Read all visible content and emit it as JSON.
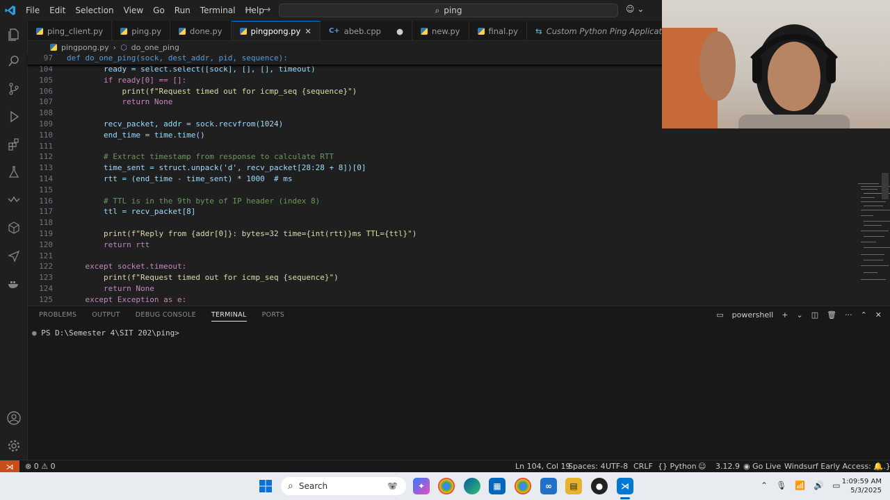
{
  "menu": [
    "File",
    "Edit",
    "Selection",
    "View",
    "Go",
    "Run",
    "Terminal",
    "Help"
  ],
  "search": {
    "text": "ping"
  },
  "tabs": [
    {
      "label": "ping_client.py",
      "type": "py",
      "active": false
    },
    {
      "label": "ping.py",
      "type": "py",
      "active": false
    },
    {
      "label": "done.py",
      "type": "py",
      "active": false
    },
    {
      "label": "pingpong.py",
      "type": "py",
      "active": true
    },
    {
      "label": "abeb.cpp",
      "type": "cpp",
      "active": false,
      "modified": true
    },
    {
      "label": "new.py",
      "type": "py",
      "active": false
    },
    {
      "label": "final.py",
      "type": "py",
      "active": false
    },
    {
      "label": "Custom Python Ping Application.c",
      "type": "preview",
      "active": false
    }
  ],
  "breadcrumb": {
    "file": "pingpong.py",
    "symbol": "do_one_ping"
  },
  "sticky": {
    "num": "97",
    "text": "def do_one_ping(sock, dest_addr, pid, sequence):"
  },
  "lines": [
    {
      "num": "104",
      "text": "        ready = select.select([sock], [], [], timeout)"
    },
    {
      "num": "105",
      "text": "        if ready[0] == []:"
    },
    {
      "num": "106",
      "text": "            print(f\"Request timed out for icmp_seq {sequence}\")"
    },
    {
      "num": "107",
      "text": "            return None"
    },
    {
      "num": "108",
      "text": ""
    },
    {
      "num": "109",
      "text": "        recv_packet, addr = sock.recvfrom(1024)"
    },
    {
      "num": "110",
      "text": "        end_time = time.time()"
    },
    {
      "num": "111",
      "text": ""
    },
    {
      "num": "112",
      "text": "        # Extract timestamp from response to calculate RTT"
    },
    {
      "num": "113",
      "text": "        time_sent = struct.unpack('d', recv_packet[28:28 + 8])[0]"
    },
    {
      "num": "114",
      "text": "        rtt = (end_time - time_sent) * 1000  # ms"
    },
    {
      "num": "115",
      "text": ""
    },
    {
      "num": "116",
      "text": "        # TTL is in the 9th byte of IP header (index 8)"
    },
    {
      "num": "117",
      "text": "        ttl = recv_packet[8]"
    },
    {
      "num": "118",
      "text": ""
    },
    {
      "num": "119",
      "text": "        print(f\"Reply from {addr[0]}: bytes=32 time={int(rtt)}ms TTL={ttl}\")"
    },
    {
      "num": "120",
      "text": "        return rtt"
    },
    {
      "num": "121",
      "text": ""
    },
    {
      "num": "122",
      "text": "    except socket.timeout:"
    },
    {
      "num": "123",
      "text": "        print(f\"Request timed out for icmp_seq {sequence}\")"
    },
    {
      "num": "124",
      "text": "        return None"
    },
    {
      "num": "125",
      "text": "    except Exception as e:"
    }
  ],
  "panel": {
    "tabs": [
      "PROBLEMS",
      "OUTPUT",
      "DEBUG CONSOLE",
      "TERMINAL",
      "PORTS"
    ],
    "active_tab": "TERMINAL",
    "shell": "powershell",
    "prompt": "PS D:\\Semester 4\\SIT 202\\ping>"
  },
  "status": {
    "problems": "0",
    "warnings": "0",
    "position": "Ln 104, Col 19",
    "spaces": "Spaces: 4",
    "encoding": "UTF-8",
    "eol": "CRLF",
    "language": "Python",
    "version": "3.12.9",
    "golive": "Go Live",
    "windsurf": "Windsurf Early Access: {...}"
  },
  "taskbar": {
    "search": "Search",
    "time": "1:09:59 AM",
    "date": "5/3/2025"
  },
  "colors": {
    "accent": "#0078d4",
    "remote": "#c74e1a"
  }
}
